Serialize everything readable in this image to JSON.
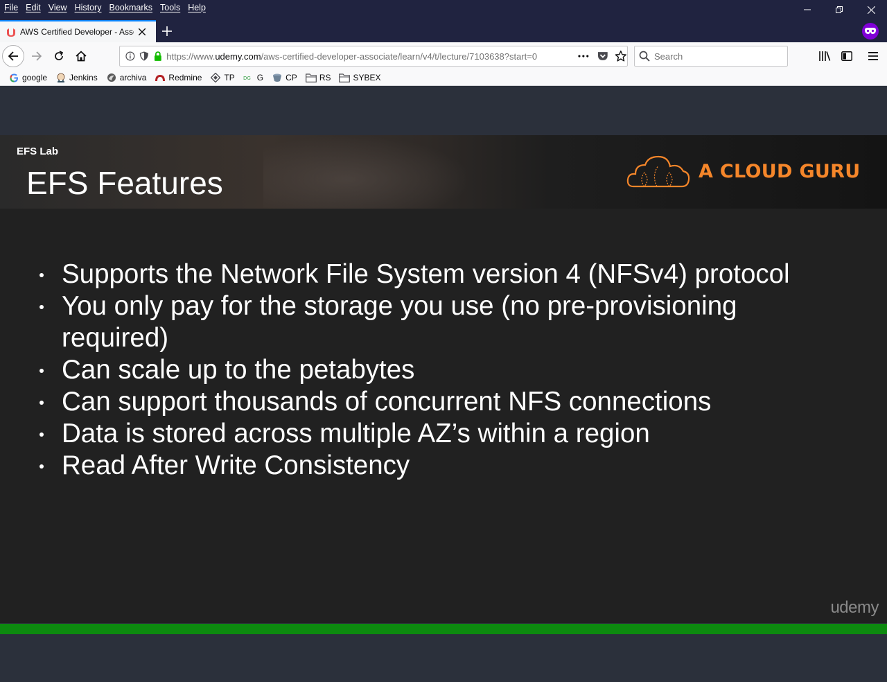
{
  "menu": [
    "File",
    "Edit",
    "View",
    "History",
    "Bookmarks",
    "Tools",
    "Help"
  ],
  "tab": {
    "title": "AWS Certified Developer - Associate"
  },
  "urlbar": {
    "prefix": "https://www.",
    "host": "udemy.com",
    "path": "/aws-certified-developer-associate/learn/v4/t/lecture/7103638?start=0"
  },
  "search": {
    "placeholder": "Search"
  },
  "bookmarks": [
    {
      "label": "google",
      "icon": "google-icon"
    },
    {
      "label": "Jenkins",
      "icon": "jenkins-icon"
    },
    {
      "label": "archiva",
      "icon": "archiva-icon"
    },
    {
      "label": "Redmine",
      "icon": "redmine-icon"
    },
    {
      "label": "TP",
      "icon": "tp-icon"
    },
    {
      "label": "G",
      "icon": "g-icon"
    },
    {
      "label": "CP",
      "icon": "cp-icon"
    },
    {
      "label": "RS",
      "icon": "folder-icon"
    },
    {
      "label": "SYBEX",
      "icon": "folder-icon"
    }
  ],
  "slide": {
    "section": "EFS Lab",
    "title": "EFS Features",
    "logo_text": "A CLOUD GURU",
    "bullets": [
      "Supports the Network File System version 4 (NFSv4) protocol",
      "You only pay for the storage you use (no pre-provisioning required)",
      "Can scale up to the petabytes",
      "Can support thousands of concurrent NFS connections",
      "Data is stored across multiple AZ’s within a region",
      "Read After Write Consistency"
    ],
    "watermark": "udemy"
  },
  "colors": {
    "accent": "#f5862a",
    "progress": "#0d8a0f",
    "titlebar": "#202340",
    "private": "#8000d7"
  }
}
